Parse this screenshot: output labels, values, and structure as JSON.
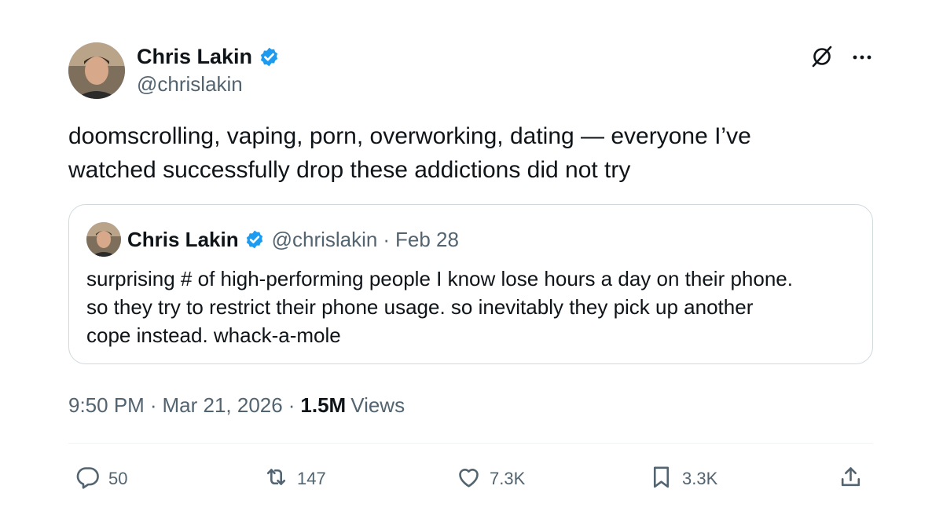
{
  "author": {
    "name": "Chris Lakin",
    "handle": "@chrislakin",
    "verified": true
  },
  "tweet": {
    "text_line1": "doomscrolling, vaping, porn, overworking, dating — everyone I’ve",
    "text_line2": "watched successfully drop these addictions did not try"
  },
  "quote": {
    "name": "Chris Lakin",
    "handle": "@chrislakin",
    "dot": "·",
    "date": "Feb 28",
    "line1": "surprising # of high-performing people I know lose hours a day on their phone.",
    "line2": "so they try to restrict their phone usage. so inevitably they pick up another",
    "line3": "cope instead. whack-a-mole"
  },
  "meta": {
    "time": "9:50 PM",
    "sep1": "·",
    "date": "Mar 21, 2026",
    "sep2": "·",
    "views_count": "1.5M",
    "views_label": "Views"
  },
  "actions": {
    "replies": "50",
    "reposts": "147",
    "likes": "7.3K",
    "bookmarks": "3.3K"
  },
  "icons": [
    "verified-badge-icon",
    "grok-icon",
    "more-icon",
    "reply-icon",
    "repost-icon",
    "like-icon",
    "bookmark-icon",
    "share-icon"
  ],
  "colors": {
    "verified": "#1d9bf0",
    "secondary_text": "#536471",
    "primary_text": "#0f1419",
    "border": "#cfd9de"
  }
}
